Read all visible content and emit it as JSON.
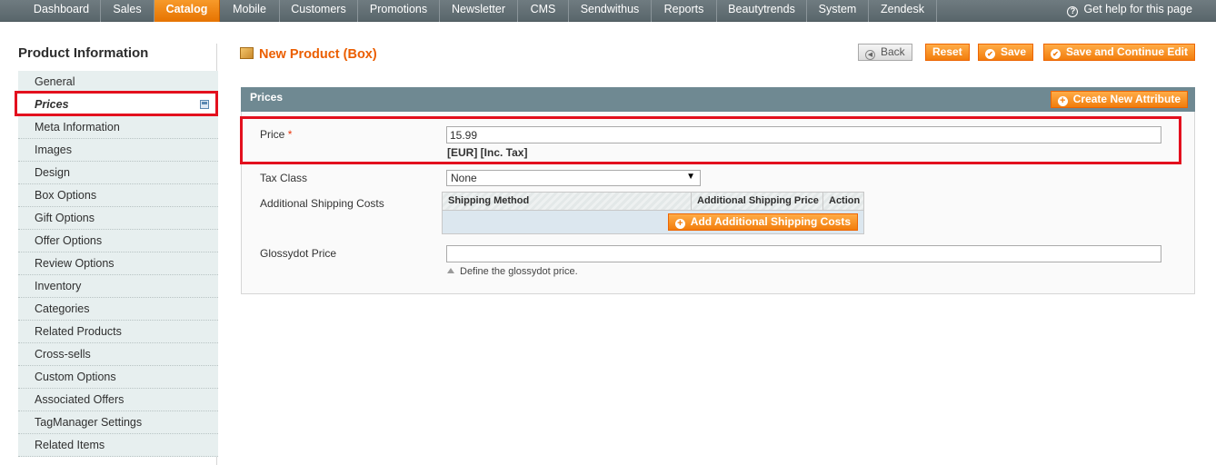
{
  "nav": {
    "items": [
      "Dashboard",
      "Sales",
      "Catalog",
      "Mobile",
      "Customers",
      "Promotions",
      "Newsletter",
      "CMS",
      "Sendwithus",
      "Reports",
      "Beautytrends",
      "System",
      "Zendesk"
    ],
    "active": "Catalog",
    "help": "Get help for this page"
  },
  "sidebar": {
    "title": "Product Information",
    "tabs": [
      "General",
      "Prices",
      "Meta Information",
      "Images",
      "Design",
      "Box Options",
      "Gift Options",
      "Offer Options",
      "Review Options",
      "Inventory",
      "Categories",
      "Related Products",
      "Cross-sells",
      "Custom Options",
      "Associated Offers",
      "TagManager Settings",
      "Related Items"
    ],
    "active": "Prices"
  },
  "header": {
    "title": "New Product (Box)",
    "buttons": {
      "back": "Back",
      "reset": "Reset",
      "save": "Save",
      "save_continue": "Save and Continue Edit"
    }
  },
  "section": {
    "title": "Prices",
    "create_attribute": "Create New Attribute"
  },
  "form": {
    "price": {
      "label": "Price",
      "required_mark": "*",
      "value": "15.99",
      "note": "[EUR] [Inc. Tax]"
    },
    "tax_class": {
      "label": "Tax Class",
      "selected": "None"
    },
    "shipping": {
      "label": "Additional Shipping Costs",
      "columns": [
        "Shipping Method",
        "Additional Shipping Price",
        "Action"
      ],
      "add_button": "Add Additional Shipping Costs"
    },
    "glossydot": {
      "label": "Glossydot Price",
      "value": "",
      "note": "Define the glossydot price."
    }
  },
  "colors": {
    "accent": "#eb5e00",
    "highlight": "#e3101e",
    "section_header": "#6f8992"
  }
}
